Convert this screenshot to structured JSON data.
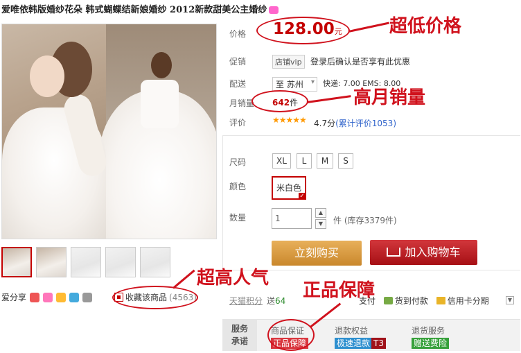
{
  "title": "爱唯依韩版婚纱花朵 韩式蝴蝶结新娘婚纱 2012新款甜美公主婚纱",
  "price": {
    "label": "价格",
    "value": "128.00",
    "unit": "元"
  },
  "promo": {
    "label": "促销",
    "badge": "店铺vip",
    "text": "登录后确认是否享有此优惠"
  },
  "shipping": {
    "label": "配送",
    "to": "至 苏州",
    "text": "快递: 7.00 EMS: 8.00"
  },
  "sales": {
    "label": "月销量",
    "value": "642",
    "unit": "件"
  },
  "rating": {
    "label": "评价",
    "stars": "★★★★★",
    "score": "4.7分",
    "link": "(累计评价1053)"
  },
  "sku": {
    "size_label": "尺码",
    "sizes": [
      "XL",
      "L",
      "M",
      "S"
    ],
    "color_label": "颜色",
    "color": "米白色",
    "qty_label": "数量",
    "qty_value": "1",
    "stock": "件 (库存3379件)"
  },
  "buttons": {
    "buy": "立刻购买",
    "cart": "加入购物车"
  },
  "share": {
    "label": "爱分享"
  },
  "favorite": {
    "label": "收藏该商品",
    "count": "(4563)"
  },
  "points": {
    "label": "天猫积分",
    "prefix": "送",
    "value": "64"
  },
  "payment": {
    "items": [
      "支付",
      "货到付款",
      "信用卡分期"
    ]
  },
  "service": {
    "head_top": "服务",
    "head_bottom": "承诺",
    "columns": [
      {
        "title": "商品保证",
        "tag": "正品保障",
        "tag_color": "#d9363e"
      },
      {
        "title": "退款权益",
        "tag": "极速退款",
        "tag2": "T3",
        "tag_color": "#2d8fcf"
      },
      {
        "title": "退货服务",
        "tag": "赠送费险",
        "tag_color": "#36a03a"
      }
    ]
  },
  "annotations": {
    "low_price": "超低价格",
    "high_sales": "高月销量",
    "popular": "超高人气",
    "genuine": "正品保障"
  },
  "colors": {
    "accent": "#c40000",
    "annotation": "#d0121d"
  }
}
